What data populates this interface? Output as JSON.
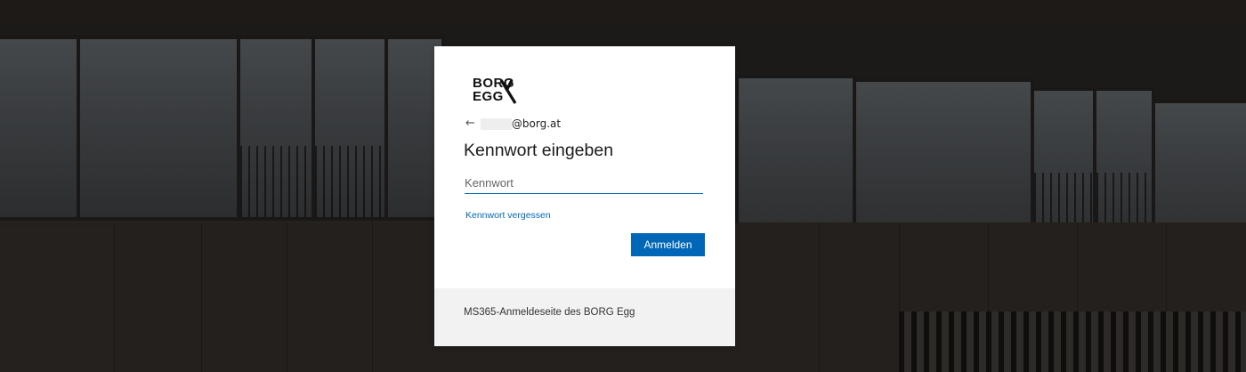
{
  "logo": {
    "line1": "BORG",
    "line2": "EGG"
  },
  "identity": {
    "back_icon": "←",
    "email_domain": "@borg.at"
  },
  "title": "Kennwort eingeben",
  "password": {
    "placeholder": "Kennwort",
    "value": ""
  },
  "forgot_link": "Kennwort vergessen",
  "signin_button": "Anmelden",
  "footer": "MS365-Anmeldeseite des BORG Egg",
  "colors": {
    "accent": "#0067b8",
    "card": "#ffffff",
    "footer_bg": "#f2f2f2"
  }
}
